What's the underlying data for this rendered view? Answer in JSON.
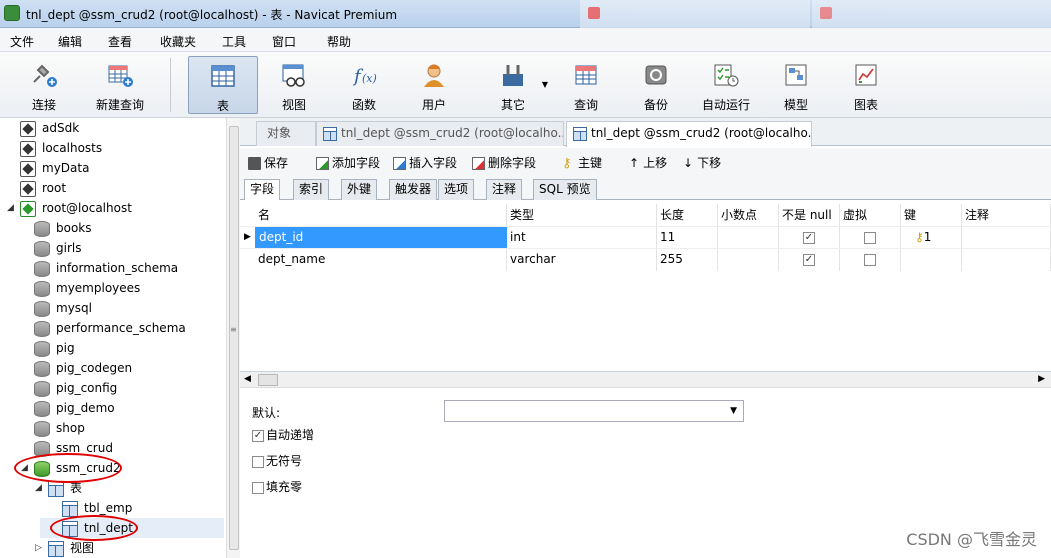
{
  "window": {
    "title": "tnl_dept @ssm_crud2 (root@localhost) - 表 - Navicat Premium"
  },
  "menubar": {
    "items": [
      "文件",
      "编辑",
      "查看",
      "收藏夹",
      "工具",
      "窗口",
      "帮助"
    ]
  },
  "toolbar": {
    "buttons": [
      {
        "label": "连接",
        "icon": "plug-icon"
      },
      {
        "label": "新建查询",
        "icon": "new-query-icon"
      },
      {
        "label": "表",
        "icon": "table-icon"
      },
      {
        "label": "视图",
        "icon": "view-icon"
      },
      {
        "label": "函数",
        "icon": "function-icon"
      },
      {
        "label": "用户",
        "icon": "user-icon"
      },
      {
        "label": "其它",
        "icon": "tools-icon"
      },
      {
        "label": "查询",
        "icon": "query-icon"
      },
      {
        "label": "备份",
        "icon": "backup-icon"
      },
      {
        "label": "自动运行",
        "icon": "schedule-icon"
      },
      {
        "label": "模型",
        "icon": "model-icon"
      },
      {
        "label": "图表",
        "icon": "chart-icon"
      }
    ],
    "active": "表"
  },
  "sidebar": {
    "connections": [
      "adSdk",
      "localhosts",
      "myData",
      "root",
      "root@localhost"
    ],
    "databases": [
      "books",
      "girls",
      "information_schema",
      "myemployees",
      "mysql",
      "performance_schema",
      "pig",
      "pig_codegen",
      "pig_config",
      "pig_demo",
      "shop",
      "ssm_crud",
      "ssm_crud2"
    ],
    "tables_folder": "表",
    "tables": [
      "tbl_emp",
      "tnl_dept"
    ],
    "views_folder": "视图",
    "selected": "tnl_dept"
  },
  "doc_tabs": {
    "objects": "对象",
    "tab1": "tnl_dept @ssm_crud2 (root@localho...",
    "tab2": "tnl_dept @ssm_crud2 (root@localho..."
  },
  "subtoolbar": {
    "save": "保存",
    "add_field": "添加字段",
    "insert_field": "插入字段",
    "delete_field": "删除字段",
    "primary_key": "主键",
    "move_up": "上移",
    "move_down": "下移"
  },
  "field_tabs": [
    "字段",
    "索引",
    "外键",
    "触发器",
    "选项",
    "注释",
    "SQL 预览"
  ],
  "grid": {
    "columns": [
      "名",
      "类型",
      "长度",
      "小数点",
      "不是 null",
      "虚拟",
      "键",
      "注释"
    ],
    "rows": [
      {
        "name": "dept_id",
        "type": "int",
        "length": "11",
        "decimals": "",
        "not_null": true,
        "virtual": false,
        "key": "1"
      },
      {
        "name": "dept_name",
        "type": "varchar",
        "length": "255",
        "decimals": "",
        "not_null": true,
        "virtual": false,
        "key": ""
      }
    ]
  },
  "properties": {
    "default_label": "默认:",
    "default_value": "",
    "auto_increment": {
      "label": "自动递增",
      "checked": true
    },
    "unsigned": {
      "label": "无符号",
      "checked": false
    },
    "zerofill": {
      "label": "填充零",
      "checked": false
    }
  },
  "watermark": "CSDN @飞雪金灵",
  "colors": {
    "selection": "#3399ff",
    "annotation": "#e00000"
  }
}
